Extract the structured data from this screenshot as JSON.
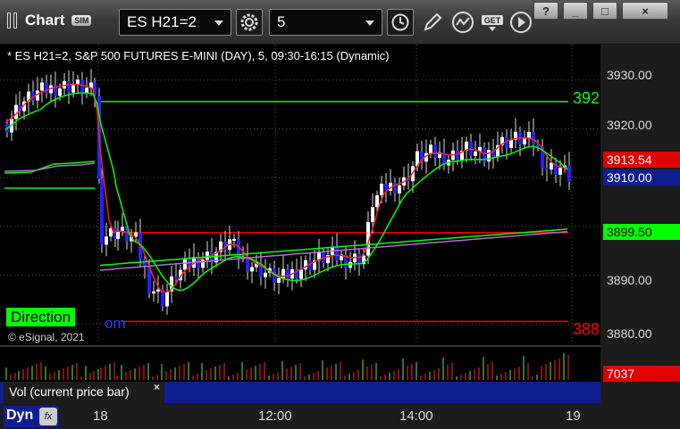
{
  "toolbar": {
    "title": "Chart",
    "sim_badge": "SIM",
    "symbol": "ES H21=2",
    "interval": "5",
    "buttons": [
      "settings-icon",
      "clock-icon",
      "pencil-icon",
      "study-icon",
      "get-icon",
      "play-icon"
    ],
    "window": {
      "restore": "?",
      "minimize": "_",
      "maximize": "□",
      "close": "×"
    }
  },
  "chart": {
    "info_line": "* ES H21=2, S&P 500 FUTURES E-MINI (DAY), 5, 09:30-16:15 (Dynamic)",
    "direction_label": "Direction",
    "direction_suffix": "om",
    "copyright": "© eSignal, 2021",
    "price_ticks": [
      "3930.00",
      "3920.00",
      "3890.00",
      "3880.00"
    ],
    "badges": {
      "last_red": "3913.54",
      "last_blue": "3910.00",
      "green_level": "3899.50",
      "volume": "7037"
    },
    "edge_labels": {
      "top_green": "392",
      "bottom_red": "388"
    },
    "vol_label": "Vol (current price bar)",
    "vol_close": "×",
    "time_ticks": [
      "18",
      "12:00",
      "14:00",
      "19"
    ],
    "dyn_label": "Dyn",
    "colors": {
      "background": "#000000",
      "bull_candle": "#ffffff",
      "bear_candle": "#2222ff",
      "fast_ma": "#ff2020",
      "trend_line": "#00ff00",
      "slow_ma": "#b070d0",
      "level_green": "#00ff00",
      "level_red": "#ff0000",
      "vol_bar": "#8a1010"
    }
  },
  "chart_data": {
    "type": "candlestick",
    "symbol": "ES H21=2",
    "interval": "5",
    "y_range": [
      3876,
      3936
    ],
    "y_ticks": [
      3930,
      3920,
      3910,
      3900,
      3890,
      3880
    ],
    "levels": [
      {
        "price": 3925.6,
        "color": "#00ff00"
      },
      {
        "price": 3898.7,
        "color": "#ff0000"
      },
      {
        "price": 3880.5,
        "color": "#ff0000"
      }
    ],
    "last_price": 3910.0,
    "last_volume": 7037
  }
}
